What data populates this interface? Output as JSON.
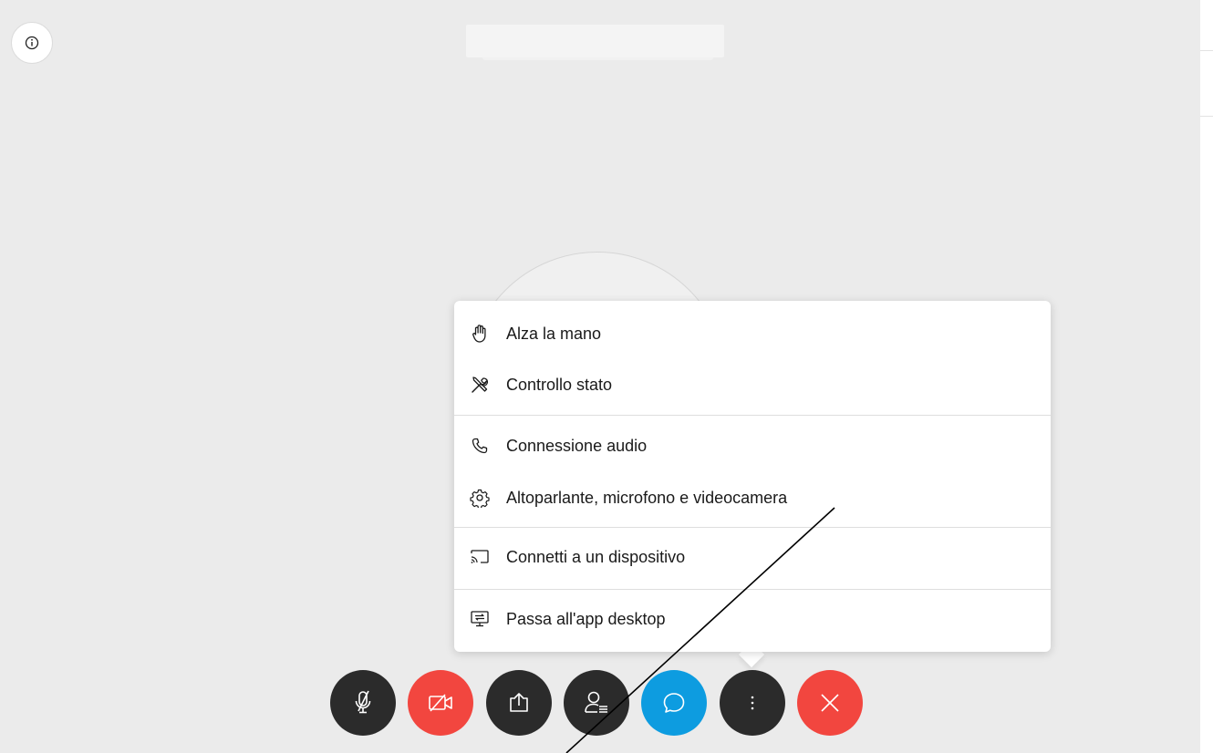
{
  "menu": {
    "items": [
      {
        "label": "Alza la mano",
        "icon": "raise-hand-icon"
      },
      {
        "label": "Controllo stato",
        "icon": "tools-icon"
      },
      {
        "label": "Connessione audio",
        "icon": "phone-icon"
      },
      {
        "label": "Altoparlante, microfono e videocamera",
        "icon": "gear-icon"
      },
      {
        "label": "Connetti a un dispositivo",
        "icon": "cast-icon"
      },
      {
        "label": "Passa all'app desktop",
        "icon": "desktop-app-icon"
      }
    ]
  },
  "controls": [
    {
      "name": "mute-microphone-button",
      "icon": "microphone-muted-icon",
      "color": "#2b2b2b"
    },
    {
      "name": "stop-video-button",
      "icon": "video-off-icon",
      "color": "#f2463f"
    },
    {
      "name": "share-screen-button",
      "icon": "share-icon",
      "color": "#2b2b2b"
    },
    {
      "name": "participants-button",
      "icon": "participants-icon",
      "color": "#2b2b2b"
    },
    {
      "name": "chat-button",
      "icon": "chat-bubble-icon",
      "color": "#0d9ce0"
    },
    {
      "name": "more-options-button",
      "icon": "more-vertical-icon",
      "color": "#2b2b2b"
    },
    {
      "name": "leave-meeting-button",
      "icon": "close-icon",
      "color": "#f2463f"
    }
  ],
  "colors": {
    "stage_background": "#ebebeb",
    "menu_background": "#ffffff",
    "dark_control": "#2b2b2b",
    "red_control": "#f2463f",
    "blue_control": "#0d9ce0"
  }
}
